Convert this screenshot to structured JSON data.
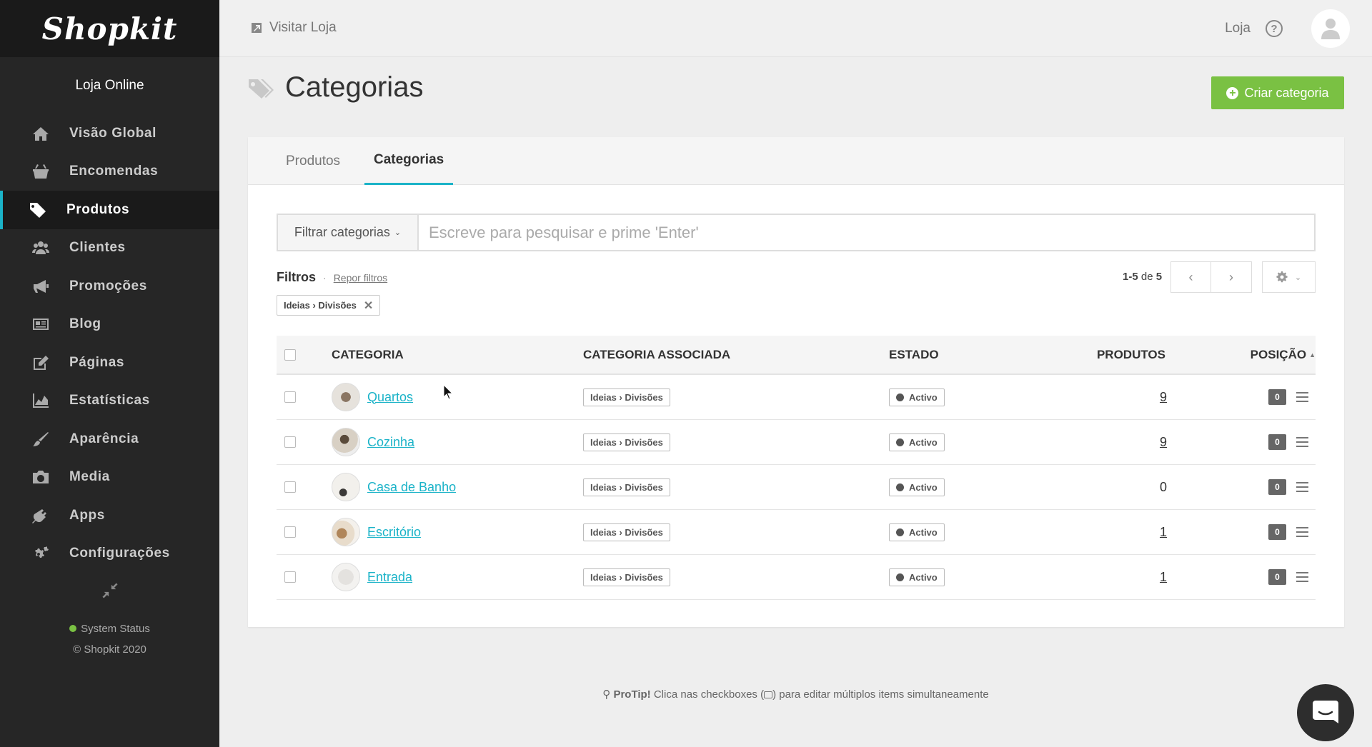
{
  "app": {
    "logo_text": "Shopkit",
    "store_name": "Loja Online"
  },
  "sidebar": {
    "items": [
      {
        "label": "Visão Global",
        "icon": "home-icon"
      },
      {
        "label": "Encomendas",
        "icon": "basket-icon"
      },
      {
        "label": "Produtos",
        "icon": "tag-icon",
        "active": true
      },
      {
        "label": "Clientes",
        "icon": "users-icon"
      },
      {
        "label": "Promoções",
        "icon": "megaphone-icon"
      },
      {
        "label": "Blog",
        "icon": "newspaper-icon"
      },
      {
        "label": "Páginas",
        "icon": "edit-icon"
      },
      {
        "label": "Estatísticas",
        "icon": "area-chart-icon"
      },
      {
        "label": "Aparência",
        "icon": "brush-icon"
      },
      {
        "label": "Media",
        "icon": "camera-icon"
      },
      {
        "label": "Apps",
        "icon": "plug-icon"
      },
      {
        "label": "Configurações",
        "icon": "gears-icon"
      }
    ],
    "system_status": "System Status",
    "copyright": "© Shopkit 2020"
  },
  "topbar": {
    "visit_store": "Visitar Loja",
    "store_link": "Loja",
    "help": "?"
  },
  "page": {
    "title": "Categorias",
    "create_button": "Criar categoria",
    "tabs": [
      {
        "label": "Produtos",
        "active": false
      },
      {
        "label": "Categorias",
        "active": true
      }
    ],
    "filter_button": "Filtrar categorias",
    "search_placeholder": "Escreve para pesquisar e prime 'Enter'",
    "filters_label": "Filtros",
    "filters_sep": "·",
    "reset_filters": "Repor filtros",
    "active_filter": "Ideias › Divisões",
    "pager_range": "1-5",
    "pager_of": "de",
    "pager_total": "5"
  },
  "table": {
    "headers": {
      "category": "CATEGORIA",
      "associated": "CATEGORIA ASSOCIADA",
      "state": "ESTADO",
      "products": "PRODUTOS",
      "position": "POSIÇÃO"
    },
    "rows": [
      {
        "name": "Quartos",
        "associated": "Ideias › Divisões",
        "state": "Activo",
        "products": "9",
        "position": "0"
      },
      {
        "name": "Cozinha",
        "associated": "Ideias › Divisões",
        "state": "Activo",
        "products": "9",
        "position": "0"
      },
      {
        "name": "Casa de Banho",
        "associated": "Ideias › Divisões",
        "state": "Activo",
        "products": "0",
        "position": "0"
      },
      {
        "name": "Escritório",
        "associated": "Ideias › Divisões",
        "state": "Activo",
        "products": "1",
        "position": "0"
      },
      {
        "name": "Entrada",
        "associated": "Ideias › Divisões",
        "state": "Activo",
        "products": "1",
        "position": "0"
      }
    ]
  },
  "protip": {
    "label": "ProTip!",
    "text_before": "Clica nas checkboxes (",
    "text_after": ") para editar múltiplos items simultaneamente"
  },
  "colors": {
    "accent": "#1bb3c8",
    "create": "#7ac143",
    "sidebar": "#262626"
  }
}
